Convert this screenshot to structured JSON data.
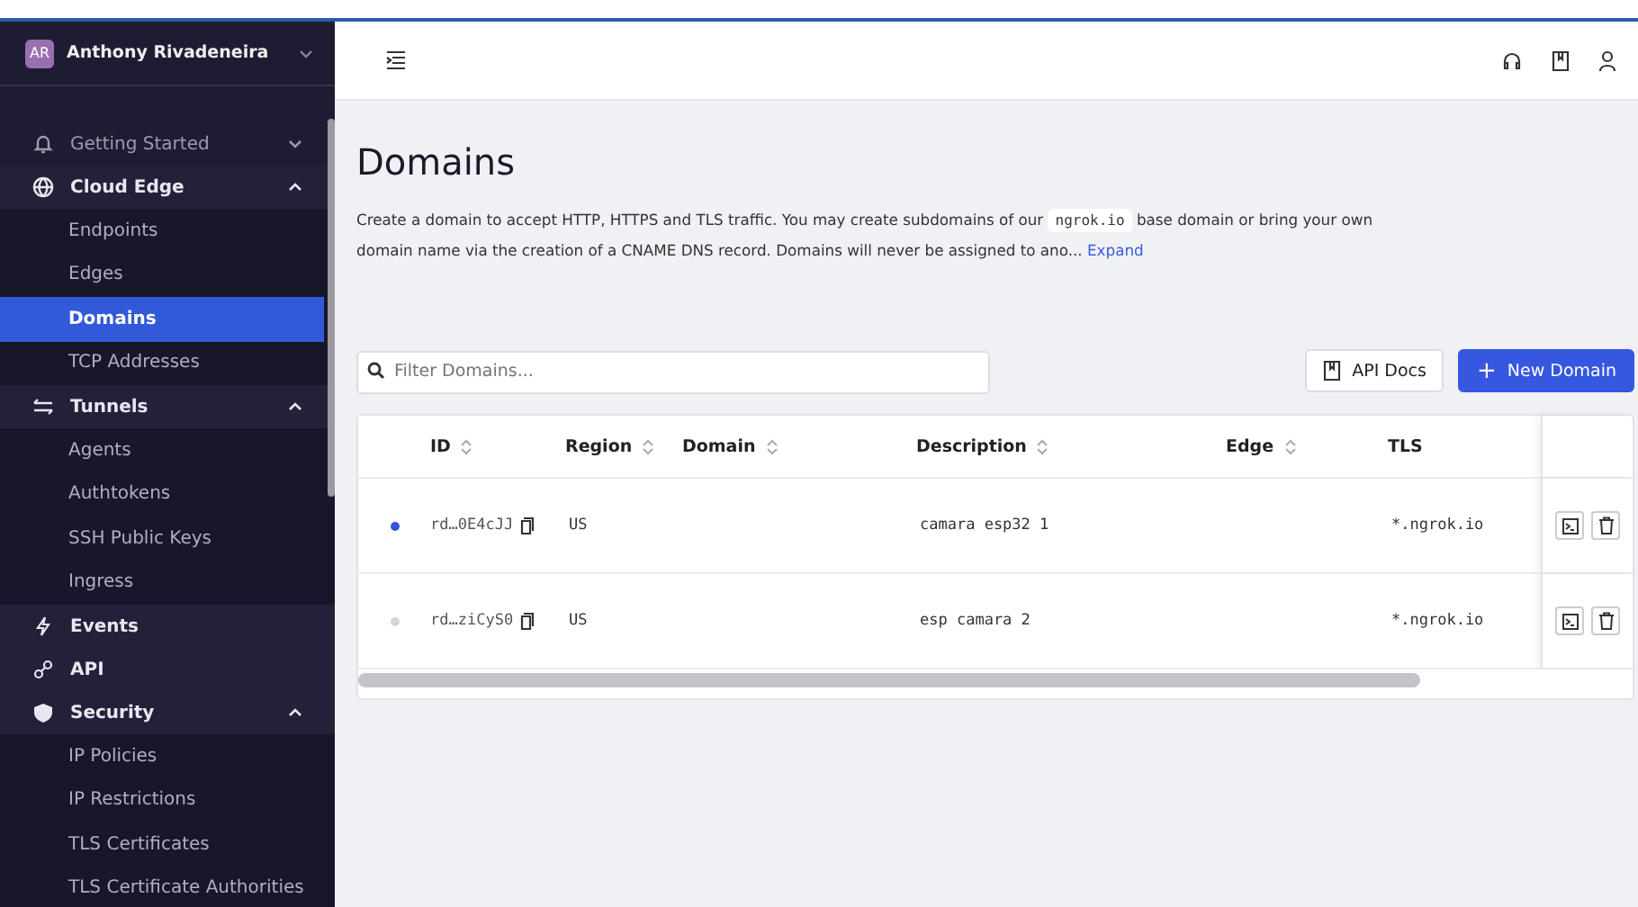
{
  "account": {
    "initials": "AR",
    "name": "Anthony Rivadeneira"
  },
  "sidebar": {
    "items": [
      {
        "label": "Getting Started",
        "expanded": false
      },
      {
        "label": "Cloud Edge",
        "expanded": true,
        "children": [
          {
            "label": "Endpoints",
            "selected": false
          },
          {
            "label": "Edges",
            "selected": false
          },
          {
            "label": "Domains",
            "selected": true
          },
          {
            "label": "TCP Addresses",
            "selected": false
          }
        ]
      },
      {
        "label": "Tunnels",
        "expanded": true,
        "children": [
          {
            "label": "Agents",
            "selected": false
          },
          {
            "label": "Authtokens",
            "selected": false
          },
          {
            "label": "SSH Public Keys",
            "selected": false
          },
          {
            "label": "Ingress",
            "selected": false
          }
        ]
      },
      {
        "label": "Events"
      },
      {
        "label": "API"
      },
      {
        "label": "Security",
        "expanded": true,
        "children": [
          {
            "label": "IP Policies",
            "selected": false
          },
          {
            "label": "IP Restrictions",
            "selected": false
          },
          {
            "label": "TLS Certificates",
            "selected": false
          },
          {
            "label": "TLS Certificate Authorities",
            "selected": false
          }
        ]
      }
    ]
  },
  "page": {
    "title": "Domains",
    "description_1": "Create a domain to accept HTTP, HTTPS and TLS traffic. You may create subdomains of our",
    "code": "ngrok.io",
    "description_2": "base domain or bring your own domain name via the creation of a CNAME DNS record. Domains will never be assigned to ano...",
    "expand_link": "Expand"
  },
  "filter": {
    "placeholder": "Filter Domains..."
  },
  "buttons": {
    "api_docs": "API Docs",
    "new_domain": "New Domain",
    "new_icon": "+"
  },
  "table": {
    "columns": [
      "ID",
      "Region",
      "Domain",
      "Description",
      "Edge",
      "TLS"
    ],
    "rows": [
      {
        "color": "#3355dd",
        "id": "rd…0E4cJJ",
        "region": "US",
        "description": "camara esp32 1",
        "tls": "*.ngrok.io"
      },
      {
        "color": "#d4d4d8",
        "id": "rd…ziCyS0",
        "region": "US",
        "description": "esp camara 2",
        "tls": "*.ngrok.io"
      }
    ]
  }
}
